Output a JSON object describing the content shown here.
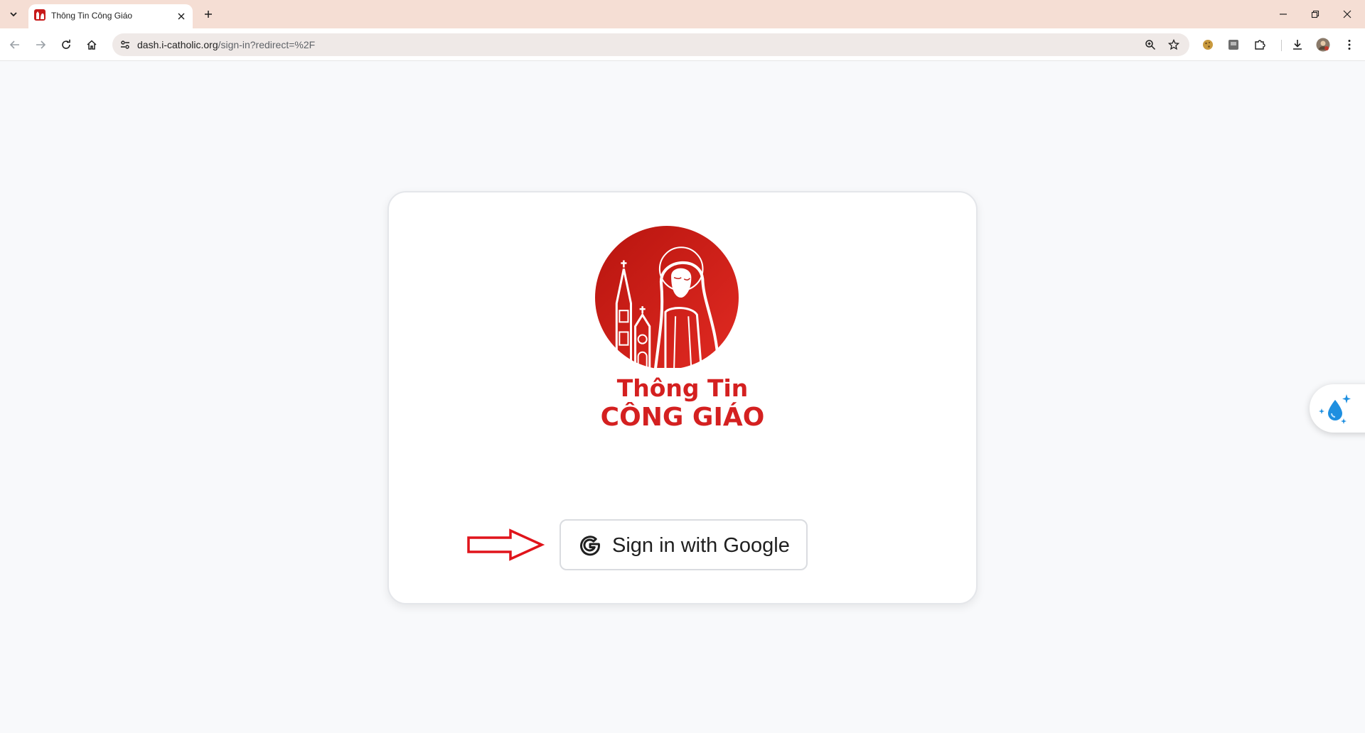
{
  "browser": {
    "tab_title": "Thông Tin Công Giáo",
    "url_host": "dash.i-catholic.org",
    "url_path": "/sign-in?redirect=%2F"
  },
  "page": {
    "brand_line1": "Thông Tin",
    "brand_line2": "CÔNG GIÁO",
    "google_button_label": "Sign in with Google"
  },
  "colors": {
    "brand_red": "#d42020",
    "tabbar_bg": "#f5ded4",
    "page_bg": "#f8f9fb",
    "annotation_arrow": "#e0141b"
  },
  "icons": [
    "tab-list-icon",
    "favicon",
    "close-icon",
    "plus-icon",
    "minimize-icon",
    "restore-icon",
    "window-close-icon",
    "back-arrow-icon",
    "forward-arrow-icon",
    "reload-icon",
    "home-icon",
    "site-info-icon",
    "zoom-icon",
    "star-icon",
    "cookie-extension-icon",
    "extension-icon",
    "puzzle-icon",
    "download-icon",
    "profile-avatar-icon",
    "more-menu-icon",
    "google-g-icon",
    "sparkle-drop-icon"
  ]
}
